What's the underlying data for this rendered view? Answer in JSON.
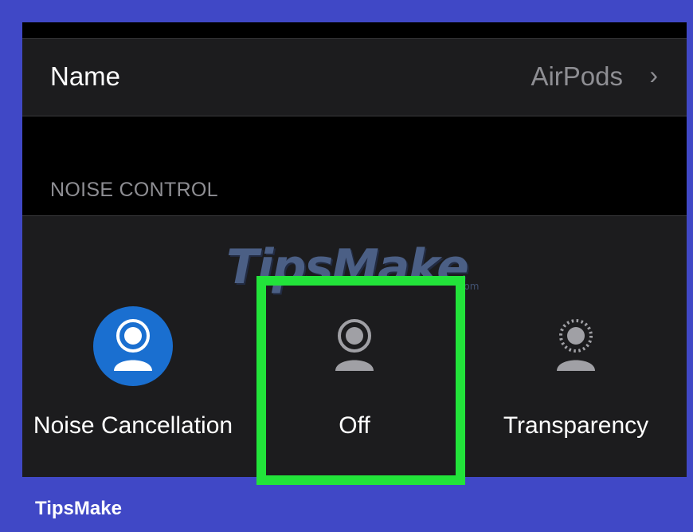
{
  "settings": {
    "name_label": "Name",
    "name_value": "AirPods",
    "chevron": "›",
    "section_header": "NOISE CONTROL"
  },
  "noise_modes": [
    {
      "label": "Noise Cancellation",
      "icon": "noise-cancellation-icon",
      "selected": true
    },
    {
      "label": "Off",
      "icon": "listening-off-icon",
      "selected": false
    },
    {
      "label": "Transparency",
      "icon": "transparency-icon",
      "selected": false
    }
  ],
  "overlay": {
    "watermark": "TipsMake",
    "watermark_suffix": ".com",
    "brand": "TipsMake",
    "highlight_target": "Off",
    "highlight_color": "#22e33a"
  },
  "colors": {
    "frame": "#4048c6",
    "accent_blue": "#1a6fd0",
    "panel": "#1c1c1e",
    "secondary_text": "#8e8e93"
  }
}
